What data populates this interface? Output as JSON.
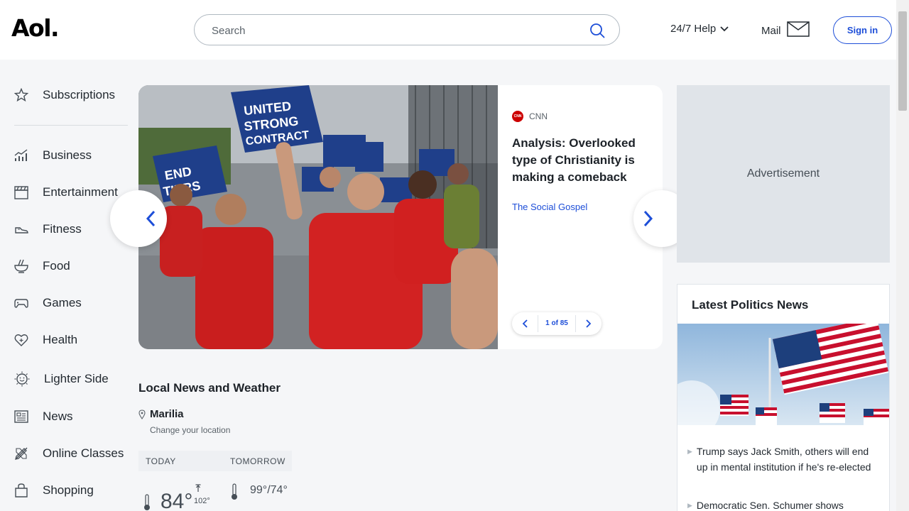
{
  "header": {
    "logo": "Aol.",
    "search_placeholder": "Search",
    "help_label": "24/7 Help",
    "mail_label": "Mail",
    "signin_label": "Sign in"
  },
  "sidebar": {
    "items": [
      {
        "label": "Subscriptions",
        "icon": "star-icon"
      },
      {
        "label": "Business",
        "icon": "chart-icon"
      },
      {
        "label": "Entertainment",
        "icon": "clapperboard-icon"
      },
      {
        "label": "Fitness",
        "icon": "sneaker-icon"
      },
      {
        "label": "Food",
        "icon": "bowl-icon"
      },
      {
        "label": "Games",
        "icon": "gamepad-icon"
      },
      {
        "label": "Health",
        "icon": "heart-plus-icon"
      },
      {
        "label": "Lighter Side",
        "icon": "smiley-icon"
      },
      {
        "label": "News",
        "icon": "newspaper-icon"
      },
      {
        "label": "Online Classes",
        "icon": "pencil-ruler-icon"
      },
      {
        "label": "Shopping",
        "icon": "shopping-bag-icon"
      }
    ]
  },
  "hero": {
    "source": "CNN",
    "headline": "Analysis: Overlooked type of Christianity is making a comeback",
    "subtopic": "The Social Gospel",
    "pager": "1 of 85"
  },
  "local": {
    "title": "Local News and Weather",
    "location": "Marilia",
    "change_location": "Change your location",
    "tab_today": "TODAY",
    "tab_tomorrow": "TOMORROW",
    "today_temp": "84°",
    "today_high": "102°",
    "tomorrow_temps": "99°/74°"
  },
  "ad": {
    "label": "Advertisement"
  },
  "politics": {
    "title": "Latest Politics News",
    "items": [
      "Trump says Jack Smith, others will end up in mental institution if he's re-elected",
      "Democratic Sen. Schumer shows"
    ]
  },
  "colors": {
    "accent_blue": "#1d4ed8",
    "cnn_red": "#cc0000",
    "page_bg": "#f5f6f8"
  }
}
